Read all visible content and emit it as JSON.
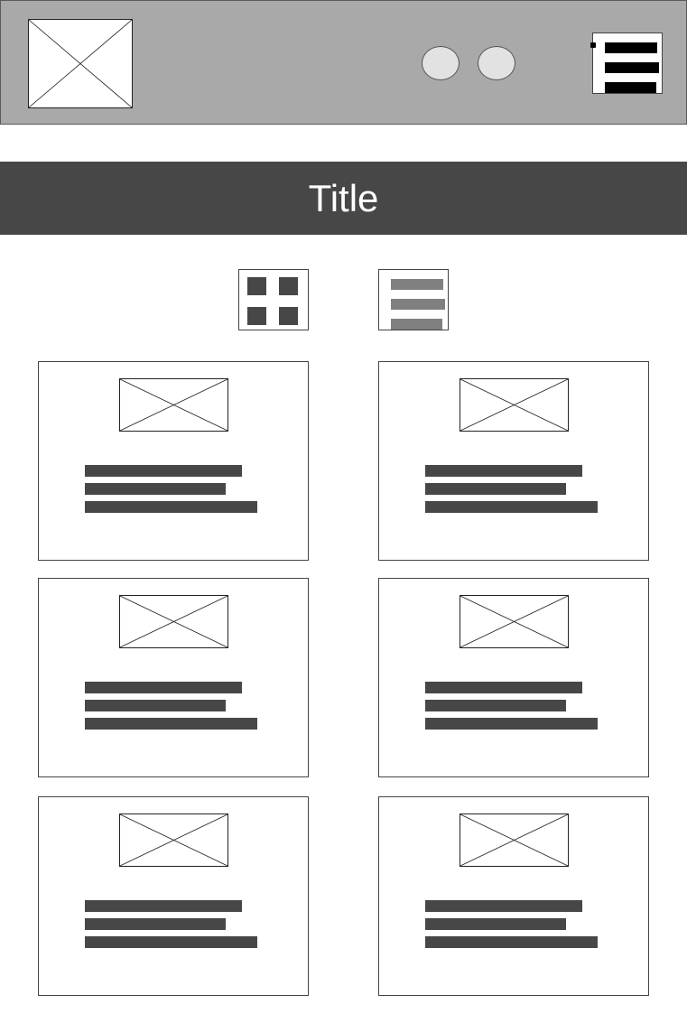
{
  "header": {
    "logo_icon": "image-placeholder-icon",
    "circle_buttons": [
      "circle-button",
      "circle-button"
    ],
    "menu_icon": "hamburger-menu-icon"
  },
  "title_bar": {
    "title": "Title"
  },
  "view_toggles": {
    "grid_icon": "grid-view-icon",
    "list_icon": "list-view-icon"
  },
  "cards": [
    {
      "thumbnail_icon": "image-placeholder-icon"
    },
    {
      "thumbnail_icon": "image-placeholder-icon"
    },
    {
      "thumbnail_icon": "image-placeholder-icon"
    },
    {
      "thumbnail_icon": "image-placeholder-icon"
    },
    {
      "thumbnail_icon": "image-placeholder-icon"
    },
    {
      "thumbnail_icon": "image-placeholder-icon"
    }
  ],
  "colors": {
    "header_bg": "#a9a9a9",
    "title_bar_bg": "#474747",
    "title_text": "#ffffff",
    "text_placeholder": "#474747",
    "list_toggle_bars": "#808080",
    "circle_button_fill": "#e2e2e2"
  }
}
